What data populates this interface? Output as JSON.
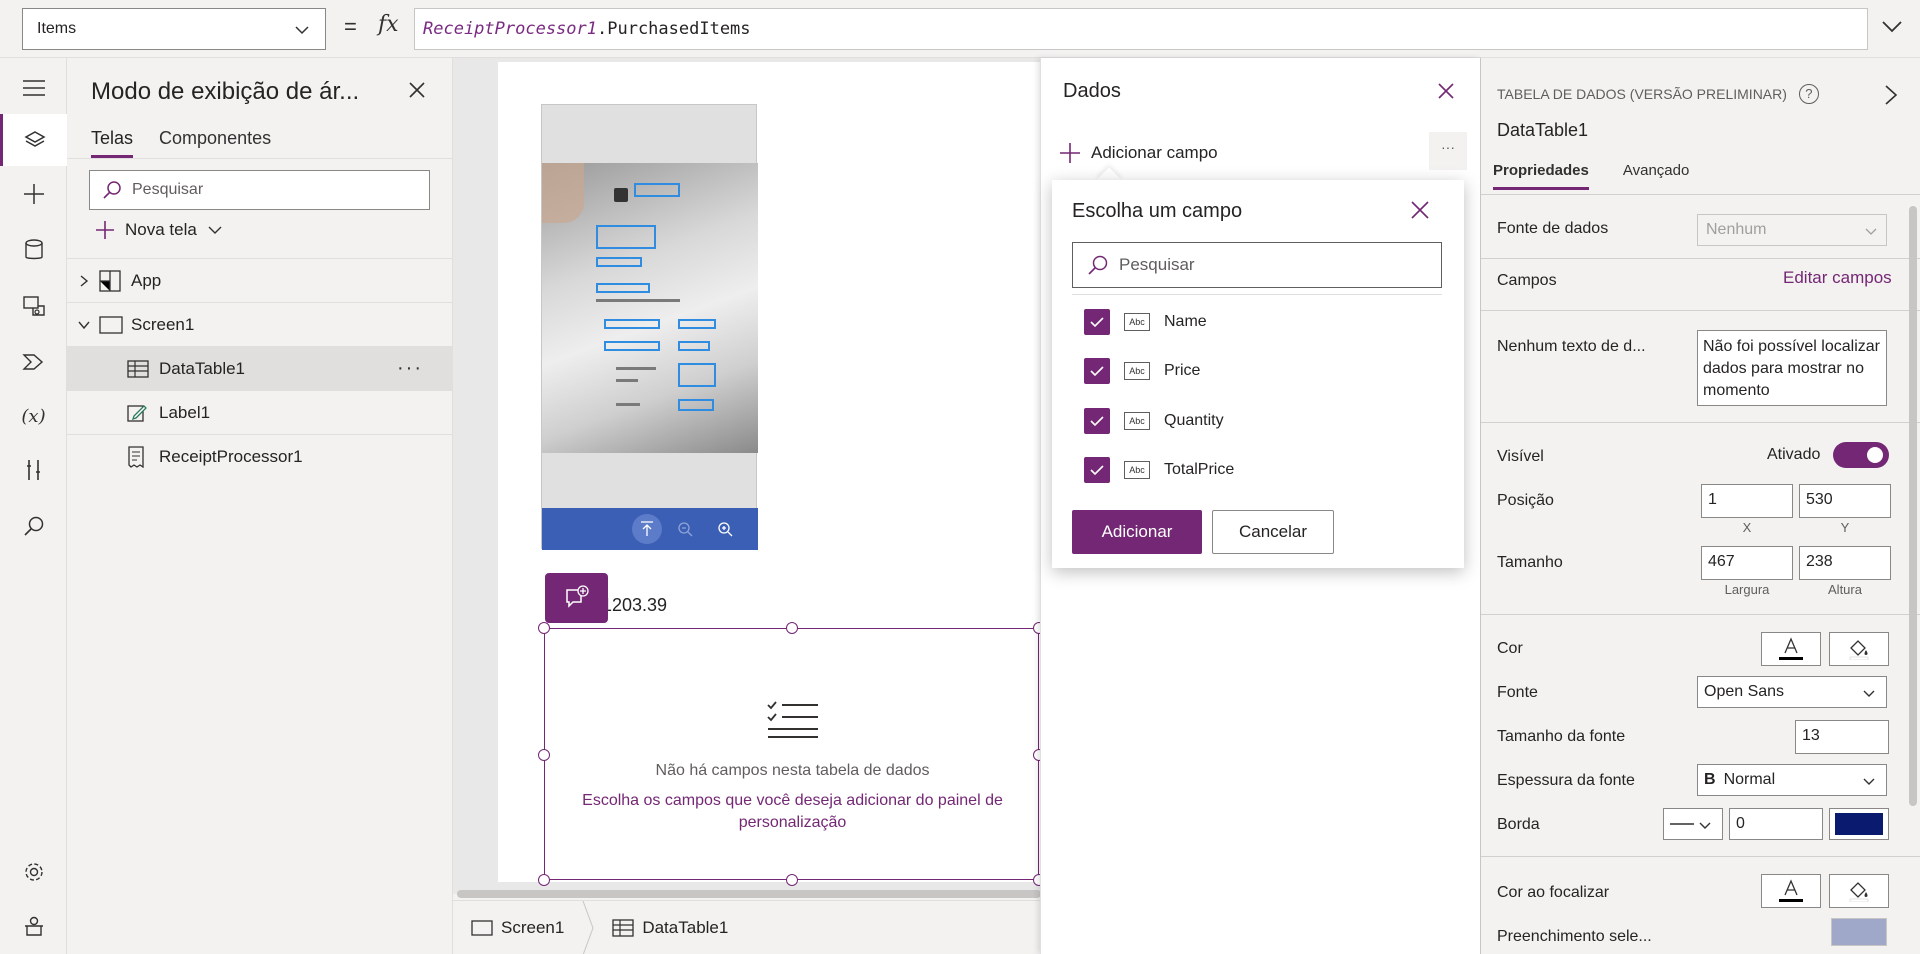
{
  "formula": {
    "property": "Items",
    "equals": "=",
    "fx": "fx",
    "identifier": "ReceiptProcessor1",
    "member": ".PurchasedItems"
  },
  "tree": {
    "title": "Modo de exibição de ár...",
    "tabs": [
      "Telas",
      "Componentes"
    ],
    "search_placeholder": "Pesquisar",
    "new_screen": "Nova tela",
    "items": [
      {
        "label": "App"
      },
      {
        "label": "Screen1"
      },
      {
        "label": "DataTable1"
      },
      {
        "label": "Label1"
      },
      {
        "label": "ReceiptProcessor1"
      }
    ],
    "more": "···"
  },
  "canvas": {
    "price_text": "1203.39",
    "empty_title": "Não há campos nesta tabela de dados",
    "empty_hint": "Escolha os campos que você deseja adicionar do painel de personalização"
  },
  "breadcrumb": [
    "Screen1",
    "DataTable1"
  ],
  "data_panel": {
    "title": "Dados",
    "add_field": "Adicionar campo",
    "more": "···"
  },
  "field_picker": {
    "title": "Escolha um campo",
    "search_placeholder": "Pesquisar",
    "type_badge": "Abc",
    "fields": [
      {
        "name": "Name",
        "checked": true
      },
      {
        "name": "Price",
        "checked": true
      },
      {
        "name": "Quantity",
        "checked": true
      },
      {
        "name": "TotalPrice",
        "checked": true
      }
    ],
    "add_button": "Adicionar",
    "cancel_button": "Cancelar"
  },
  "properties": {
    "control_type": "TABELA DE DADOS (VERSÃO PRELIMINAR)",
    "help": "?",
    "control_name": "DataTable1",
    "tabs": [
      "Propriedades",
      "Avançado"
    ],
    "data_source_label": "Fonte de dados",
    "data_source_value": "Nenhum",
    "fields_label": "Campos",
    "edit_fields": "Editar campos",
    "no_data_label": "Nenhum texto de d...",
    "no_data_value": "Não foi possível localizar dados para mostrar no momento",
    "visible_label": "Visível",
    "visible_value": "Ativado",
    "position_label": "Posição",
    "x": "1",
    "y": "530",
    "x_caption": "X",
    "y_caption": "Y",
    "size_label": "Tamanho",
    "width": "467",
    "height": "238",
    "width_caption": "Largura",
    "height_caption": "Altura",
    "color_label": "Cor",
    "font_label": "Fonte",
    "font_value": "Open Sans",
    "font_size_label": "Tamanho da fonte",
    "font_size_value": "13",
    "font_weight_label": "Espessura da fonte",
    "font_weight_value": "Normal",
    "border_label": "Borda",
    "border_value": "0",
    "border_color": "#0a1a6e",
    "hover_color_label": "Cor ao focalizar",
    "selection_fill_label": "Preenchimento sele..."
  },
  "colors": {
    "accent": "#742774"
  }
}
